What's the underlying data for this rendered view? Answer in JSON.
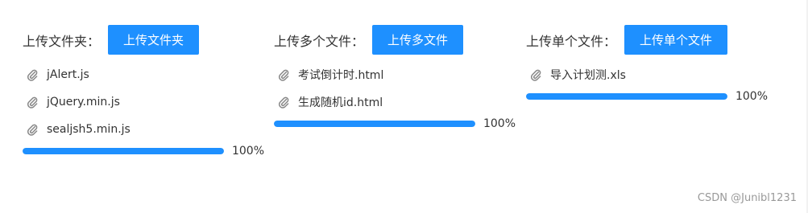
{
  "groups": [
    {
      "label": "上传文件夹：",
      "button": "上传文件夹",
      "files": [
        "jAlert.js",
        "jQuery.min.js",
        "sealjsh5.min.js"
      ],
      "progress": {
        "value": 100,
        "text": "100%"
      }
    },
    {
      "label": "上传多个文件：",
      "button": "上传多文件",
      "files": [
        "考试倒计时.html",
        "生成随机id.html"
      ],
      "progress": {
        "value": 100,
        "text": "100%"
      }
    },
    {
      "label": "上传单个文件：",
      "button": "上传单个文件",
      "files": [
        "导入计划测.xls"
      ],
      "progress": {
        "value": 100,
        "text": "100%"
      }
    }
  ],
  "watermark": "CSDN @Junibl1231",
  "colors": {
    "accent": "#1e90ff",
    "text": "#333333",
    "icon": "#888888"
  },
  "icons": {
    "file": "paperclip-icon"
  }
}
